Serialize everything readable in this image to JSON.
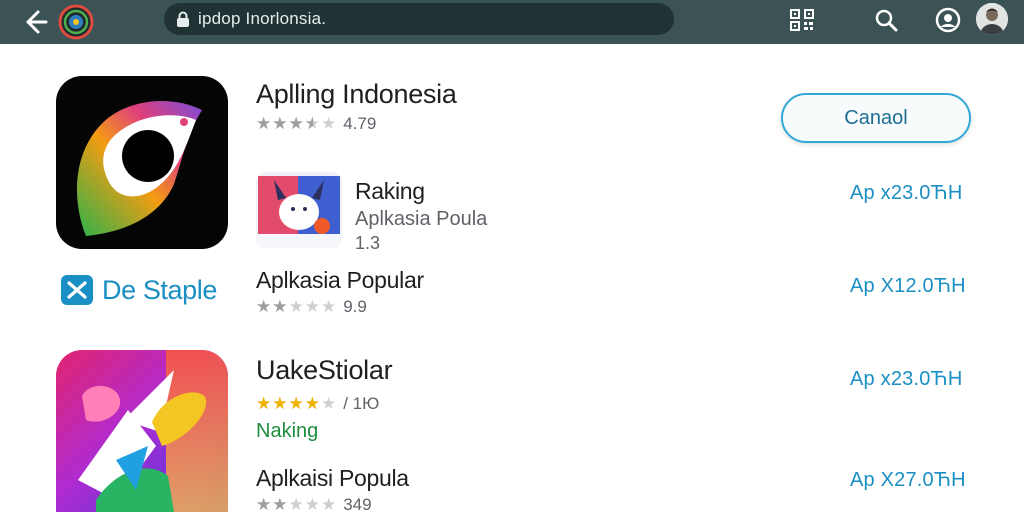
{
  "browser": {
    "url": "ipdop Inorlonsia.",
    "icons": [
      "back-arrow-icon",
      "site-logo-icon",
      "lock-icon",
      "qr-code-icon",
      "search-icon",
      "account-icon",
      "avatar"
    ]
  },
  "featured": {
    "title": "Aplling Indonesia",
    "rating": 3.5,
    "rating_text": "4.79",
    "cancel_label": "Canaol"
  },
  "developer": {
    "name": "De Staple"
  },
  "items": [
    {
      "title": "Raking",
      "subtitle": "Aplkasia Poula",
      "meta": "1.3",
      "price": "Ap x23.0ЋH"
    },
    {
      "title": "Aplkasia Popular",
      "rating": 2,
      "rating_text": "9.9",
      "price": "Ap X12.0ЋH"
    },
    {
      "title": "UakeStiolar",
      "rating": 4,
      "rating_text": "/ 1Ю",
      "tag": "Naking",
      "price": "Ap x23.0ЋH"
    },
    {
      "title": "Aplkaisi Popula",
      "rating": 2,
      "rating_text": "349",
      "price": "Ap X27.0ЋH"
    }
  ],
  "colors": {
    "topbar": "#3b5354",
    "urlbar": "#203233",
    "accent": "#1a8fc3",
    "button_border": "#32a8d6",
    "star_gray": "#9e9e9e",
    "star_gold": "#f1b100",
    "tag_green": "#1e8e3e"
  }
}
